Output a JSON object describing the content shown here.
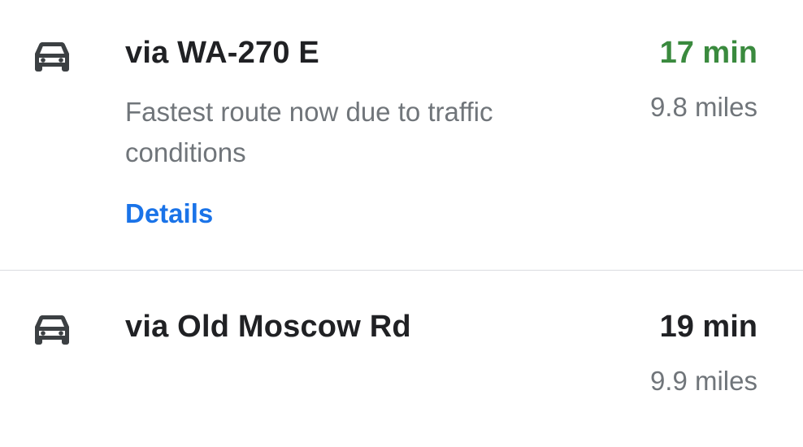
{
  "routes": [
    {
      "icon": "car-icon",
      "name": "via WA-270 E",
      "description": "Fastest route now due to traffic conditions",
      "details_label": "Details",
      "duration": "17 min",
      "duration_color": "#3a8a3e",
      "distance": "9.8 miles",
      "selected": true
    },
    {
      "icon": "car-icon",
      "name": "via Old Moscow Rd",
      "duration": "19 min",
      "duration_color": "#202124",
      "distance": "9.9 miles",
      "selected": false
    }
  ],
  "colors": {
    "primary_text": "#202124",
    "secondary_text": "#70757a",
    "link": "#1a73e8",
    "fastest": "#3a8a3e",
    "divider": "#dadce0"
  }
}
